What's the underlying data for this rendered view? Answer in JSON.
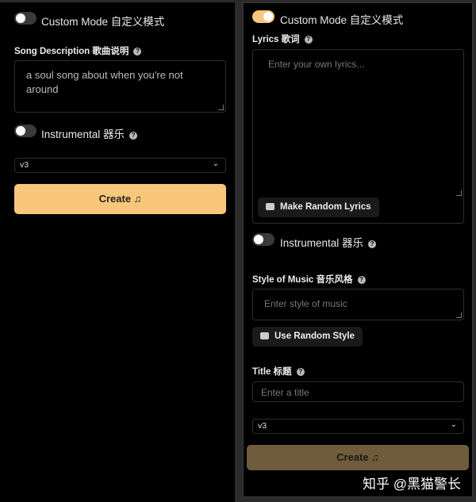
{
  "left": {
    "custom_mode": {
      "label": "Custom Mode 自定义模式",
      "on": false
    },
    "song_description": {
      "label": "Song Description 歌曲说明",
      "value": "a  soul song about when you're not around"
    },
    "instrumental": {
      "label": "Instrumental 器乐",
      "on": false
    },
    "model": {
      "value": "v3"
    },
    "create_label": "Create"
  },
  "right": {
    "custom_mode": {
      "label": "Custom Mode 自定义模式",
      "on": true
    },
    "lyrics": {
      "label": "Lyrics 歌词",
      "placeholder": "Enter your own lyrics...",
      "random_button": "Make Random Lyrics"
    },
    "instrumental": {
      "label": "Instrumental 器乐",
      "on": false
    },
    "style": {
      "label": "Style of Music 音乐风格",
      "placeholder": "Enter style of music",
      "random_button": "Use Random Style"
    },
    "title": {
      "label": "Title 标题",
      "placeholder": "Enter a title"
    },
    "model": {
      "value": "v3"
    },
    "create_label": "Create"
  },
  "watermark": "知乎 @黑猫警长",
  "colors": {
    "accent": "#f8c77a",
    "accent_disabled": "#6e5c3c",
    "background": "#000000"
  },
  "icons": {
    "help": "question-circle-icon",
    "music": "music-note-icon",
    "random": "dice-icon",
    "dropdown": "chevron-down-icon"
  }
}
